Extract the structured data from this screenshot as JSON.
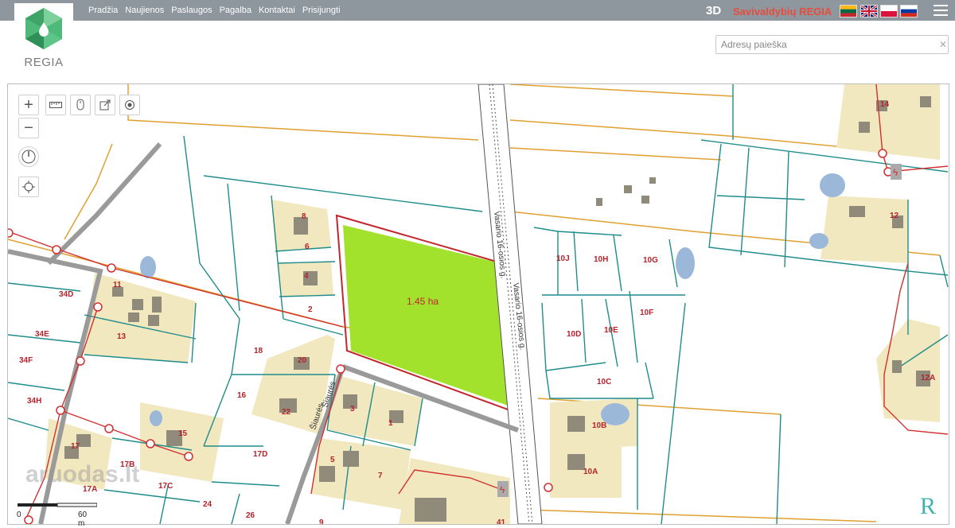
{
  "nav": {
    "items": [
      "Pradžia",
      "Naujienos",
      "Paslaugos",
      "Pagalba",
      "Kontaktai",
      "Prisijungti"
    ]
  },
  "logo": {
    "text": "REGIA"
  },
  "header": {
    "mode_3d": "3D",
    "brand": "Savivaldybių REGIA",
    "languages": [
      "lt",
      "en",
      "pl",
      "ru"
    ]
  },
  "search": {
    "placeholder": "Adresų paieška",
    "value": ""
  },
  "map": {
    "area_label": "1.45 ha",
    "watermark": "aruodas.lt",
    "scale": {
      "start": "0",
      "end": "60 m"
    },
    "streets": {
      "north": "Vasario 16-osios g.",
      "north2": "Vasario 16-osios g.",
      "siaures": "Šiaurės",
      "siaures2": "Šiaurės"
    },
    "parcels": [
      "8",
      "6",
      "4",
      "2",
      "11",
      "34D",
      "34E",
      "34F",
      "34H",
      "13",
      "18",
      "20",
      "16",
      "22",
      "15",
      "17",
      "17A",
      "17B",
      "17C",
      "17D",
      "24",
      "26",
      "9",
      "3",
      "1",
      "5",
      "7",
      "41",
      "14",
      "12",
      "12A",
      "10J",
      "10H",
      "10G",
      "10D",
      "10E",
      "10F",
      "10C",
      "10B",
      "10A"
    ],
    "colors": {
      "parcel_line": "#1f8c8c",
      "boundary": "#e0a030",
      "power": "#d13030",
      "selected": "#a3e22c",
      "building_area": "#f2e8c0",
      "water": "#9bb8d9",
      "building": "#8f8a7a"
    }
  },
  "controls": {
    "zoom_in": "+",
    "zoom_out": "−"
  }
}
